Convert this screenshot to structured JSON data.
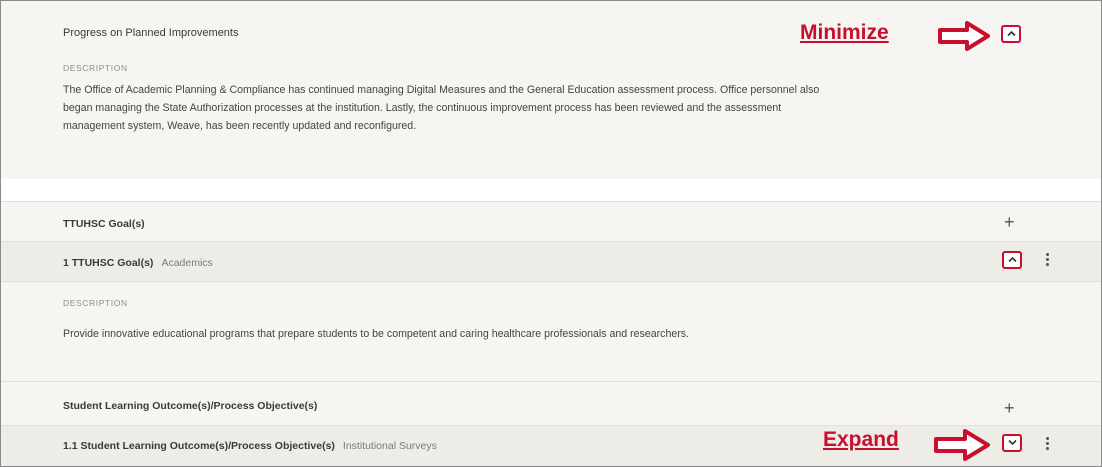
{
  "section1": {
    "title": "Progress on Planned Improvements",
    "desc_label": "DESCRIPTION",
    "desc_lines": [
      "The Office of Academic Planning & Compliance has continued managing Digital Measures and the General Education assessment process. Office personnel also",
      "began managing the State Authorization processes at the institution. Lastly, the continuous improvement process has been reviewed and the assessment",
      "management system, Weave, has been recently updated and reconfigured."
    ]
  },
  "goals": {
    "header": "TTUHSC Goal(s)",
    "item_title": "1 TTUHSC Goal(s)",
    "item_sub": "Academics",
    "desc_label": "DESCRIPTION",
    "desc_text": "Provide innovative educational programs that prepare students to be competent and caring healthcare professionals and researchers."
  },
  "slo": {
    "header": "Student Learning Outcome(s)/Process Objective(s)",
    "item_title": "1.1 Student Learning Outcome(s)/Process Objective(s)",
    "item_sub": "Institutional Surveys"
  },
  "annotations": {
    "minimize": "Minimize",
    "expand": "Expand"
  },
  "icons": {
    "plus": "+",
    "collapse": "chevron-up-icon",
    "expand": "chevron-down-icon",
    "more": "kebab-menu-icon"
  },
  "colors": {
    "accent": "#c8102e",
    "background": "#f6f5f2"
  }
}
